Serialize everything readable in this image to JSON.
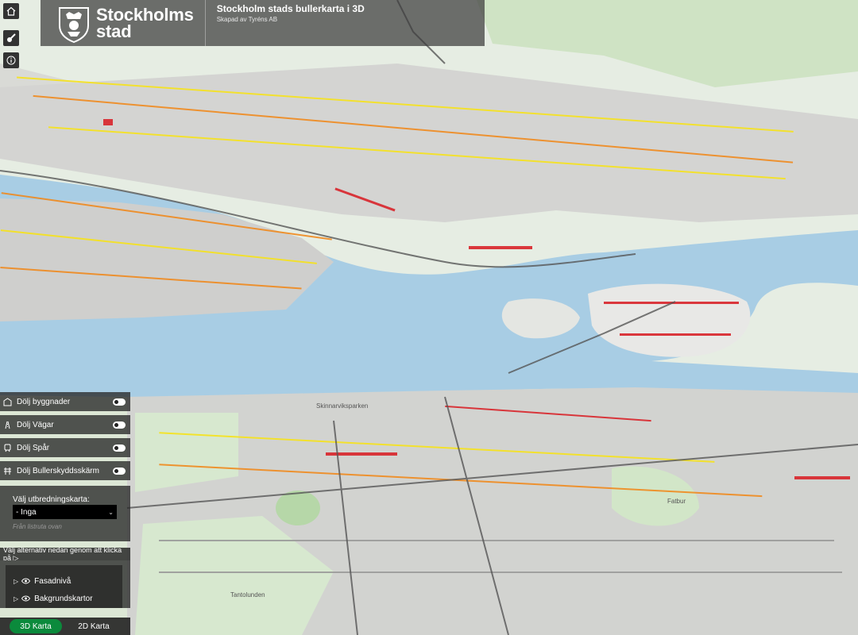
{
  "header": {
    "logo_line1": "Stockholms",
    "logo_line2": "stad",
    "title": "Stockholm stads bullerkarta i 3D",
    "subtitle": "Skapad av Tyréns AB"
  },
  "sidebar_buttons": [
    {
      "icon": "home-icon"
    },
    {
      "icon": "paint-icon"
    },
    {
      "icon": "info-icon"
    }
  ],
  "toggles": [
    {
      "label": "Dölj byggnader",
      "icon": "building-icon",
      "on": false
    },
    {
      "label": "Dölj Vägar",
      "icon": "road-icon",
      "on": false
    },
    {
      "label": "Dölj Spår",
      "icon": "train-icon",
      "on": false
    },
    {
      "label": "Dölj Bullerskyddsskärm",
      "icon": "barrier-icon",
      "on": false
    }
  ],
  "spread": {
    "label": "Välj utbredningskarta:",
    "selected": "- Inga",
    "hint": "Från listruta ovan"
  },
  "choose_hint": "Välj alternativ nedan genom att klicka på ▷",
  "layers": [
    {
      "label": "Fasadnivå"
    },
    {
      "label": "Bakgrundskartor"
    }
  ],
  "view_tabs": {
    "tab_3d": "3D Karta",
    "tab_2d": "2D Karta"
  },
  "map_labels": {
    "park": "Skinnarviksparken",
    "street": "Tantolunden",
    "fatbur": "Fatbur"
  },
  "colors": {
    "accent_green": "#0b8a3c",
    "water": "#a8cde4",
    "noise_red": "#d9232a",
    "noise_orange": "#f08a1d",
    "noise_yellow": "#f6e21a"
  }
}
